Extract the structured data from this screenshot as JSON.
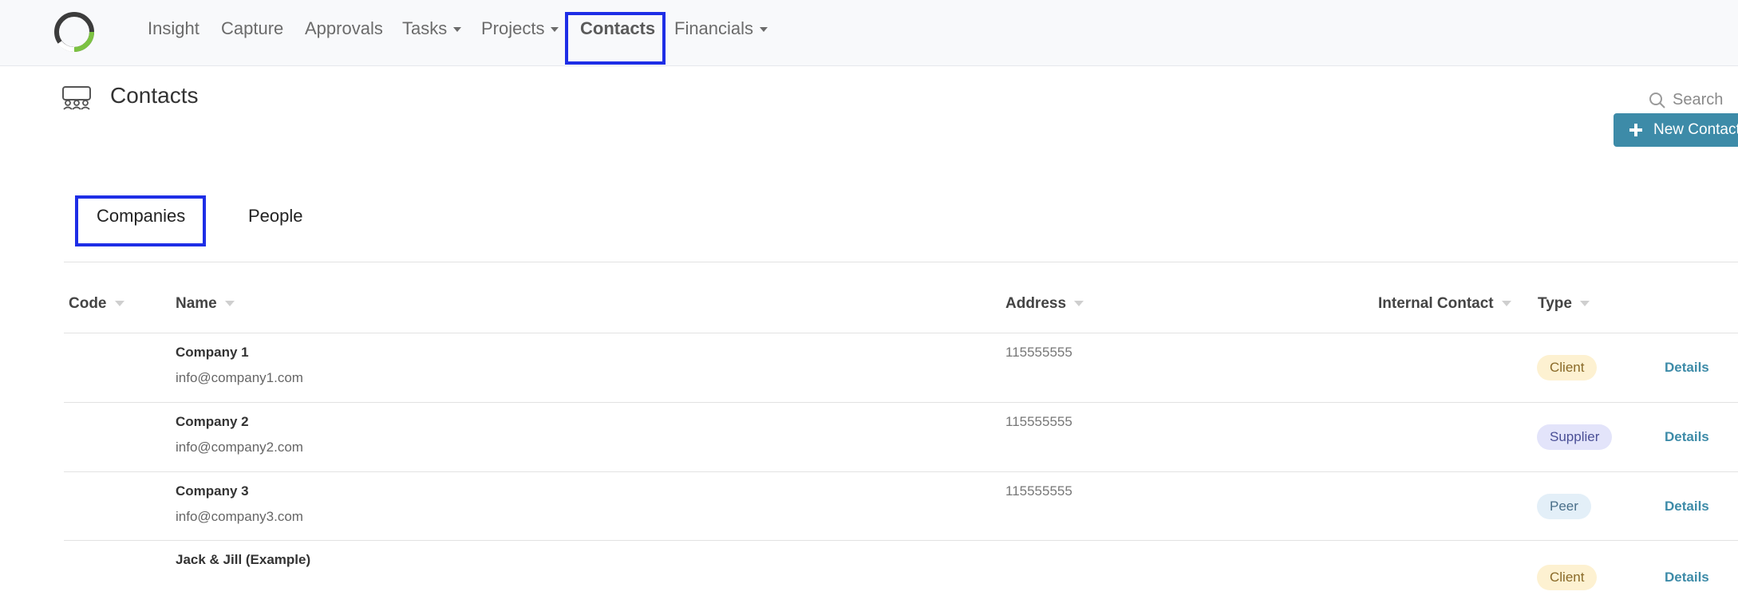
{
  "nav": {
    "insight": "Insight",
    "capture": "Capture",
    "approvals": "Approvals",
    "tasks": "Tasks",
    "projects": "Projects",
    "contacts": "Contacts",
    "financials": "Financials"
  },
  "page": {
    "title": "Contacts",
    "search_label": "Search",
    "new_button": "New Contact"
  },
  "tabs": {
    "companies": "Companies",
    "people": "People"
  },
  "table": {
    "headers": {
      "code": "Code",
      "name": "Name",
      "address": "Address",
      "internal_contact": "Internal Contact",
      "type": "Type"
    },
    "rows": [
      {
        "code": "",
        "name": "Company 1",
        "email": "info@company1.com",
        "address": "115555555",
        "internal_contact": "",
        "type": "Client",
        "action": "Details"
      },
      {
        "code": "",
        "name": "Company 2",
        "email": "info@company2.com",
        "address": "115555555",
        "internal_contact": "",
        "type": "Supplier",
        "action": "Details"
      },
      {
        "code": "",
        "name": "Company 3",
        "email": "info@company3.com",
        "address": "115555555",
        "internal_contact": "",
        "type": "Peer",
        "action": "Details"
      },
      {
        "code": "",
        "name": "Jack & Jill (Example)",
        "email": "",
        "address": "",
        "internal_contact": "",
        "type": "Client",
        "action": "Details"
      }
    ]
  },
  "colors": {
    "accent": "#3d8ba8",
    "highlight": "#1e2ee6",
    "badge_client_bg": "#fdf1d1",
    "badge_supplier_bg": "#e3e4fa",
    "badge_peer_bg": "#e3eff8"
  },
  "icons": {
    "logo": "ring-logo-icon",
    "page": "people-group-icon",
    "search": "search-icon",
    "add": "plus-icon"
  }
}
